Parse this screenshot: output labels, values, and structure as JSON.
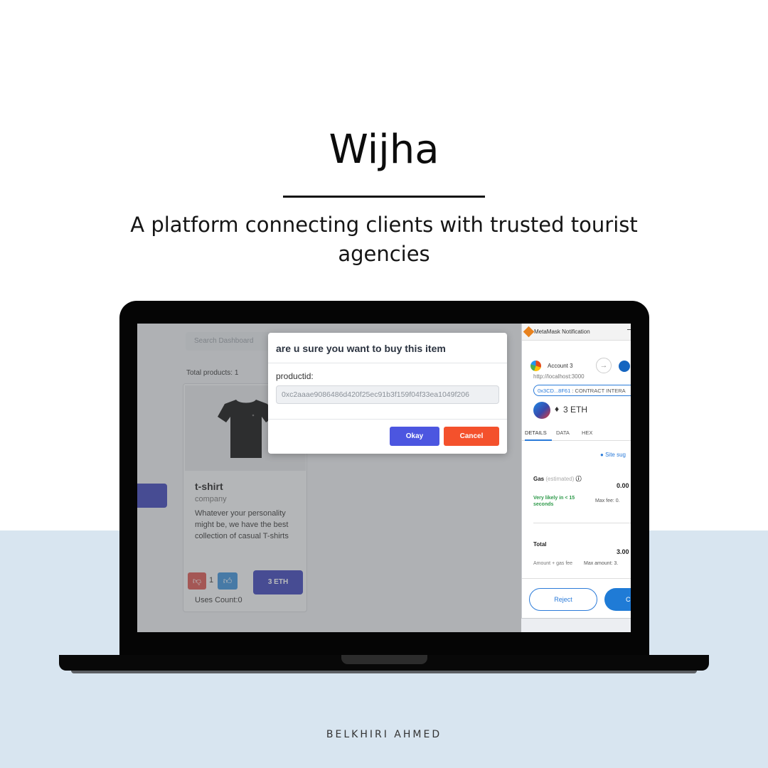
{
  "slide": {
    "title": "Wijha",
    "subtitle": "A platform connecting clients with trusted tourist agencies",
    "author": "BELKHIRI AHMED"
  },
  "dashboard": {
    "search_placeholder": "Search Dashboard",
    "total_products": "Total products: 1",
    "product": {
      "name": "t-shirt",
      "category": "company",
      "description": "Whatever your personality might be, we have the best collection of casual T-shirts",
      "likes": "1",
      "price_button": "3 ETH",
      "uses_count": "Uses Count:0"
    }
  },
  "dialog": {
    "title": "are u sure you want to buy this item",
    "field_label": "productid:",
    "field_value": "0xc2aaae9086486d420f25ec91b3f159f04f33ea1049f206",
    "okay_label": "Okay",
    "cancel_label": "Cancel"
  },
  "metamask": {
    "window_title": "MetaMask Notification",
    "account": "Account 3",
    "origin": "http://localhost:3000",
    "contract_address": "0x3CD...8F61",
    "contract_label": " : CONTRACT INTERA",
    "amount": "3 ETH",
    "tabs": [
      "DETAILS",
      "DATA",
      "HEX"
    ],
    "site_suggested": "Site sug",
    "gas_label": "Gas",
    "gas_sub": "(estimated)",
    "gas_value": "0.00",
    "likely": "Very likely in < 15 seconds",
    "max_fee": "Max fee: 0.",
    "total_label": "Total",
    "total_value": "3.00",
    "amount_gas_fee": "Amount + gas fee",
    "max_amount": "Max amount: 3.",
    "reject_label": "Reject",
    "confirm_label": "C"
  }
}
